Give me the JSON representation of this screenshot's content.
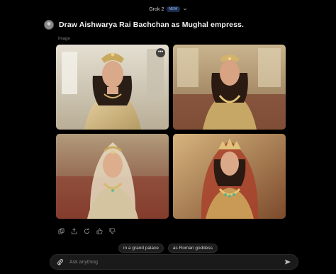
{
  "header": {
    "model_name": "Grok 2",
    "badge": "NEW",
    "dropdown_icon": "chevron-down-icon"
  },
  "conversation": {
    "user_avatar_icon": "user-avatar-icon",
    "prompt": "Draw Aishwarya Rai Bachchan as Mughal empress.",
    "image_section_label": "Image"
  },
  "images": [
    {
      "description": "Generated portrait 1"
    },
    {
      "description": "Generated portrait 2"
    },
    {
      "description": "Generated portrait 3"
    },
    {
      "description": "Generated portrait 4"
    }
  ],
  "image_menu_icon": "more-options-icon",
  "actions": [
    "copy-icon",
    "share-icon",
    "regenerate-icon",
    "thumbs-up-icon",
    "thumbs-down-icon"
  ],
  "suggestions": [
    "in a grand palace",
    "as Roman goddess"
  ],
  "composer": {
    "placeholder": "Ask anything",
    "attach_icon": "paperclip-icon",
    "send_icon": "send-icon"
  },
  "colors": {
    "background": "#000000",
    "surface": "#1a1a1a",
    "badge_text": "#9ec3ff"
  }
}
